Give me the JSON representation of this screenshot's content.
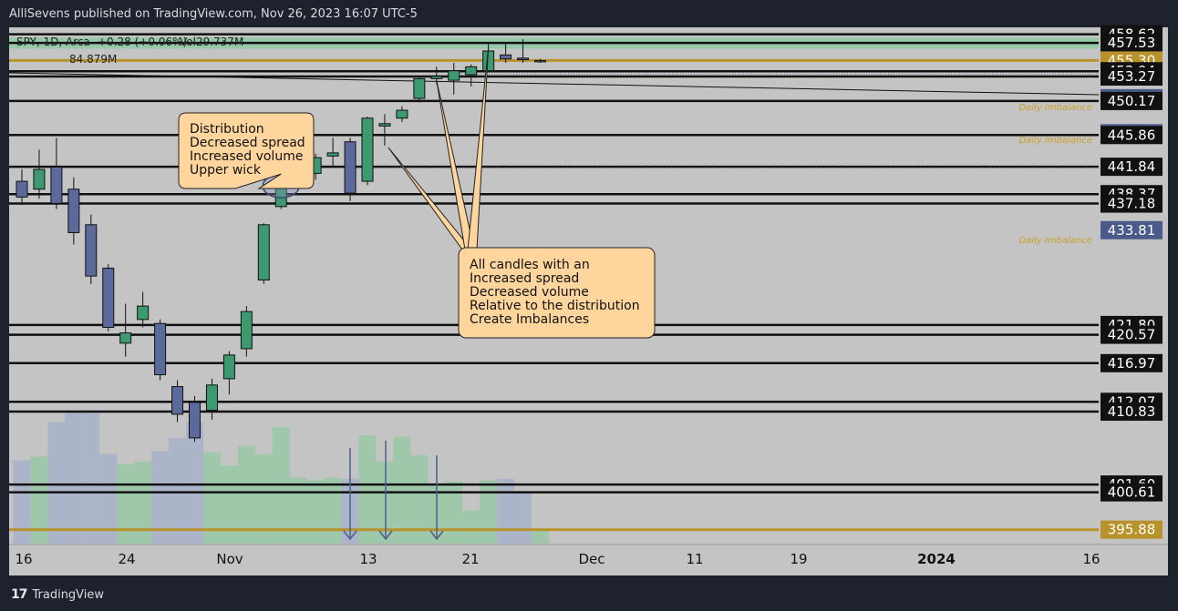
{
  "header": {
    "publish_line": "AlllSevens published on TradingView.com, Nov 26, 2023 16:07 UTC-5"
  },
  "footer": {
    "brand": "TradingView"
  },
  "legend": {
    "symbol_line": "SPY, 1D, Arca",
    "change": "+0.28 (+0.06%)",
    "volume": "Vol29.737M",
    "vol_ma": "84.879M"
  },
  "colors": {
    "bull": "#3d9970",
    "bear": "#5b6a9a",
    "plot_bg": "#c4c4c4",
    "annotation_fill": "#ffd59e",
    "imbalance_text": "#c9a227",
    "vol_bull": "#9bc9a7",
    "vol_bear": "#a9b3c9",
    "gold_line": "#b8922a",
    "blue_badge": "#4a5a8a"
  },
  "annotations": {
    "distribution": [
      "Distribution",
      "Decreased spread",
      "Increased volume",
      "Upper wick"
    ],
    "imbalance": [
      "All candles with an",
      "Increased spread",
      "Decreased volume",
      "Relative to the distribution",
      "Create Imbalances"
    ],
    "imbalance_label": "Daily Imbalance"
  },
  "chart_data": {
    "type": "candlestick",
    "symbol": "SPY",
    "timeframe": "1D",
    "ylim": [
      394,
      459.5
    ],
    "x_tick_labels": [
      "16",
      "24",
      "Nov",
      "13",
      "21",
      "Dec",
      "11",
      "19",
      "2024",
      "16"
    ],
    "price_levels": [
      {
        "value": 458.62,
        "style": "dark"
      },
      {
        "value": 457.53,
        "style": "dark"
      },
      {
        "value": 455.3,
        "style": "gold"
      },
      {
        "value": 453.94,
        "style": "dark"
      },
      {
        "value": 453.27,
        "style": "dark"
      },
      {
        "value": 450.52,
        "style": "blue"
      },
      {
        "value": 450.17,
        "style": "dark"
      },
      {
        "value": 446.09,
        "style": "blue"
      },
      {
        "value": 445.86,
        "style": "dark"
      },
      {
        "value": 441.84,
        "style": "dark"
      },
      {
        "value": 438.37,
        "style": "dark"
      },
      {
        "value": 437.18,
        "style": "dark"
      },
      {
        "value": 433.81,
        "style": "blue"
      },
      {
        "value": 421.8,
        "style": "dark"
      },
      {
        "value": 420.57,
        "style": "dark"
      },
      {
        "value": 416.97,
        "style": "dark"
      },
      {
        "value": 412.07,
        "style": "dark"
      },
      {
        "value": 410.83,
        "style": "dark"
      },
      {
        "value": 401.6,
        "style": "dark"
      },
      {
        "value": 400.61,
        "style": "dark"
      },
      {
        "value": 395.88,
        "style": "gold"
      }
    ],
    "imbalance_levels": [
      453.94,
      450.17,
      441.84
    ],
    "candles": [
      {
        "o": 440.0,
        "h": 441.5,
        "l": 437.0,
        "c": 438.0
      },
      {
        "o": 439.0,
        "h": 444.0,
        "l": 437.8,
        "c": 441.5
      },
      {
        "o": 441.8,
        "h": 445.5,
        "l": 436.5,
        "c": 437.2
      },
      {
        "o": 439.0,
        "h": 440.5,
        "l": 432.0,
        "c": 433.5
      },
      {
        "o": 434.5,
        "h": 435.8,
        "l": 427.0,
        "c": 428.0
      },
      {
        "o": 429.0,
        "h": 429.5,
        "l": 421.0,
        "c": 421.5
      },
      {
        "o": 419.5,
        "h": 424.5,
        "l": 417.8,
        "c": 420.8
      },
      {
        "o": 422.5,
        "h": 426.0,
        "l": 421.5,
        "c": 424.2
      },
      {
        "o": 422.0,
        "h": 422.5,
        "l": 414.8,
        "c": 415.5
      },
      {
        "o": 414.0,
        "h": 414.8,
        "l": 409.5,
        "c": 410.5
      },
      {
        "o": 412.0,
        "h": 412.8,
        "l": 407.0,
        "c": 407.5
      },
      {
        "o": 411.0,
        "h": 415.0,
        "l": 409.8,
        "c": 414.2
      },
      {
        "o": 415.0,
        "h": 418.5,
        "l": 413.0,
        "c": 418.0
      },
      {
        "o": 418.8,
        "h": 424.2,
        "l": 417.8,
        "c": 423.5
      },
      {
        "o": 427.5,
        "h": 434.7,
        "l": 427.0,
        "c": 434.5
      },
      {
        "o": 436.8,
        "h": 441.0,
        "l": 436.5,
        "c": 440.0
      },
      {
        "o": 440.2,
        "h": 442.0,
        "l": 439.0,
        "c": 440.5
      },
      {
        "o": 441.0,
        "h": 443.5,
        "l": 440.2,
        "c": 443.0
      },
      {
        "o": 443.2,
        "h": 445.5,
        "l": 441.8,
        "c": 443.6
      },
      {
        "o": 445.0,
        "h": 445.5,
        "l": 437.5,
        "c": 438.5
      },
      {
        "o": 440.0,
        "h": 448.2,
        "l": 439.5,
        "c": 448.0
      },
      {
        "o": 447.0,
        "h": 448.5,
        "l": 444.5,
        "c": 447.3
      },
      {
        "o": 448.0,
        "h": 449.5,
        "l": 447.5,
        "c": 449.0
      },
      {
        "o": 450.5,
        "h": 453.3,
        "l": 450.0,
        "c": 453.0
      },
      {
        "o": 453.0,
        "h": 454.5,
        "l": 452.3,
        "c": 453.3
      },
      {
        "o": 452.8,
        "h": 455.0,
        "l": 451.0,
        "c": 454.0
      },
      {
        "o": 453.5,
        "h": 454.8,
        "l": 452.0,
        "c": 454.5
      },
      {
        "o": 454.0,
        "h": 457.4,
        "l": 453.8,
        "c": 456.5
      },
      {
        "o": 456.0,
        "h": 457.5,
        "l": 455.0,
        "c": 455.5
      },
      {
        "o": 455.6,
        "h": 458.0,
        "l": 455.0,
        "c": 455.4
      },
      {
        "o": 455.2,
        "h": 455.5,
        "l": 455.0,
        "c": 455.3
      }
    ],
    "volume_relative": [
      0.63,
      0.66,
      0.92,
      0.99,
      0.99,
      0.68,
      0.6,
      0.62,
      0.7,
      0.8,
      0.92,
      0.69,
      0.59,
      0.74,
      0.68,
      0.88,
      0.5,
      0.48,
      0.5,
      0.49,
      0.82,
      0.62,
      0.81,
      0.67,
      0.45,
      0.47,
      0.25,
      0.48,
      0.49,
      0.4,
      0.1
    ]
  }
}
